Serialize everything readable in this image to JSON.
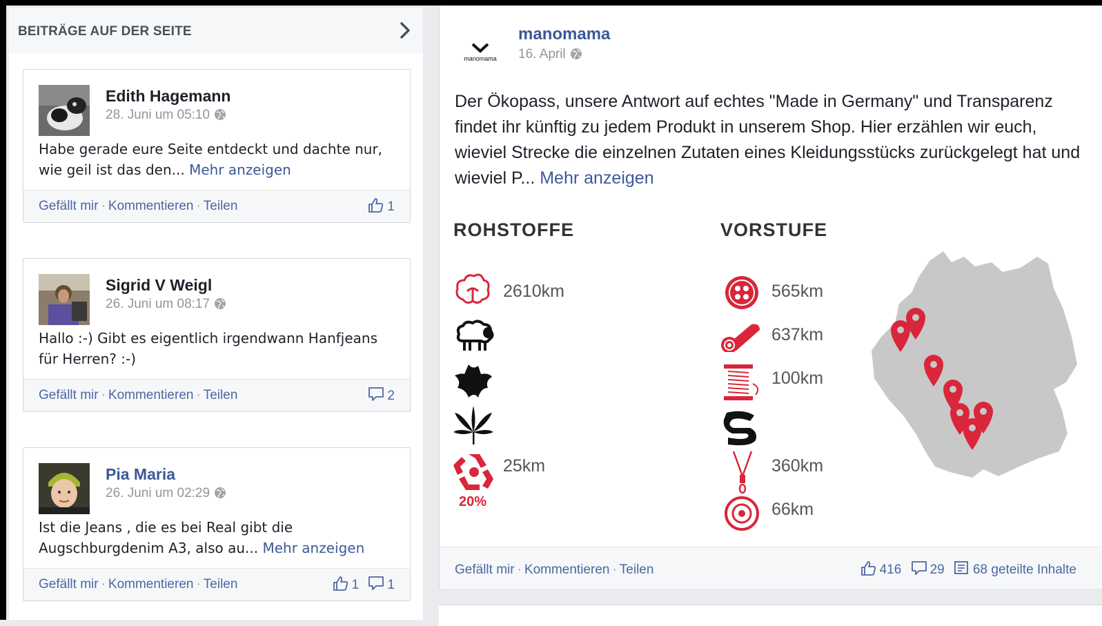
{
  "sidebar": {
    "title": "BEITRÄGE AUF DER SEITE",
    "posts": [
      {
        "author": "Edith Hagemann",
        "date": "28. Juni um 05:10",
        "text": "Habe gerade eure Seite entdeckt und dachte nur, wie geil ist das den...",
        "more": "Mehr anzeigen",
        "actions": [
          "Gefällt mir",
          "Kommentieren",
          "Teilen"
        ],
        "likes": "1"
      },
      {
        "author": "Sigrid V Weigl",
        "date": "26. Juni um 08:17",
        "text": "Hallo :-) Gibt es eigentlich irgendwann Hanfjeans für Herren? :-)",
        "actions": [
          "Gefällt mir",
          "Kommentieren",
          "Teilen"
        ],
        "comments": "2"
      },
      {
        "author": "Pia Maria",
        "date": "26. Juni um 02:29",
        "text": "Ist die Jeans , die es bei Real gibt die Augschburgdenim A3, also au...",
        "more": "Mehr anzeigen",
        "actions": [
          "Gefällt mir",
          "Kommentieren",
          "Teilen"
        ],
        "likes": "1",
        "comments": "1"
      }
    ]
  },
  "post": {
    "logo_text": "manomama",
    "author": "manomama",
    "date": "16. April",
    "text": "Der Ökopass, unsere Antwort auf echtes \"Made in Germany\" und Transparenz findet ihr künftig zu jedem Produkt in unserem Shop. Hier erzählen wir euch, wieviel Strecke die einzelnen Zutaten eines Kleidungsstücks zurückgelegt hat und wieviel P...",
    "more": "Mehr anzeigen",
    "infographic": {
      "rohstoffe_title": "ROHSTOFFE",
      "vorstufe_title": "VORSTUFE",
      "rohstoffe": [
        {
          "icon": "cotton-icon",
          "km": "2610km"
        },
        {
          "icon": "sheep-icon",
          "km": ""
        },
        {
          "icon": "leather-icon",
          "km": ""
        },
        {
          "icon": "hemp-leaf-icon",
          "km": ""
        },
        {
          "icon": "recycling-icon",
          "km": "25km",
          "percent": "20%"
        }
      ],
      "vorstufe": [
        {
          "icon": "button-icon",
          "km": "565km"
        },
        {
          "icon": "fabric-roll-icon",
          "km": "637km"
        },
        {
          "icon": "thread-spool-icon",
          "km": "100km"
        },
        {
          "icon": "ribbon-icon",
          "km": ""
        },
        {
          "icon": "zipper-icon",
          "km": "360km"
        },
        {
          "icon": "rivet-icon",
          "km": "66km"
        }
      ],
      "accent_color": "#d9263a",
      "map_color": "#c8c8c8"
    },
    "actions": [
      "Gefällt mir",
      "Kommentieren",
      "Teilen"
    ],
    "likes": "416",
    "comments": "29",
    "shares": "68 geteilte Inhalte"
  },
  "colors": {
    "link": "#3b5998",
    "action": "#4b67a1",
    "meta": "#90949c"
  }
}
